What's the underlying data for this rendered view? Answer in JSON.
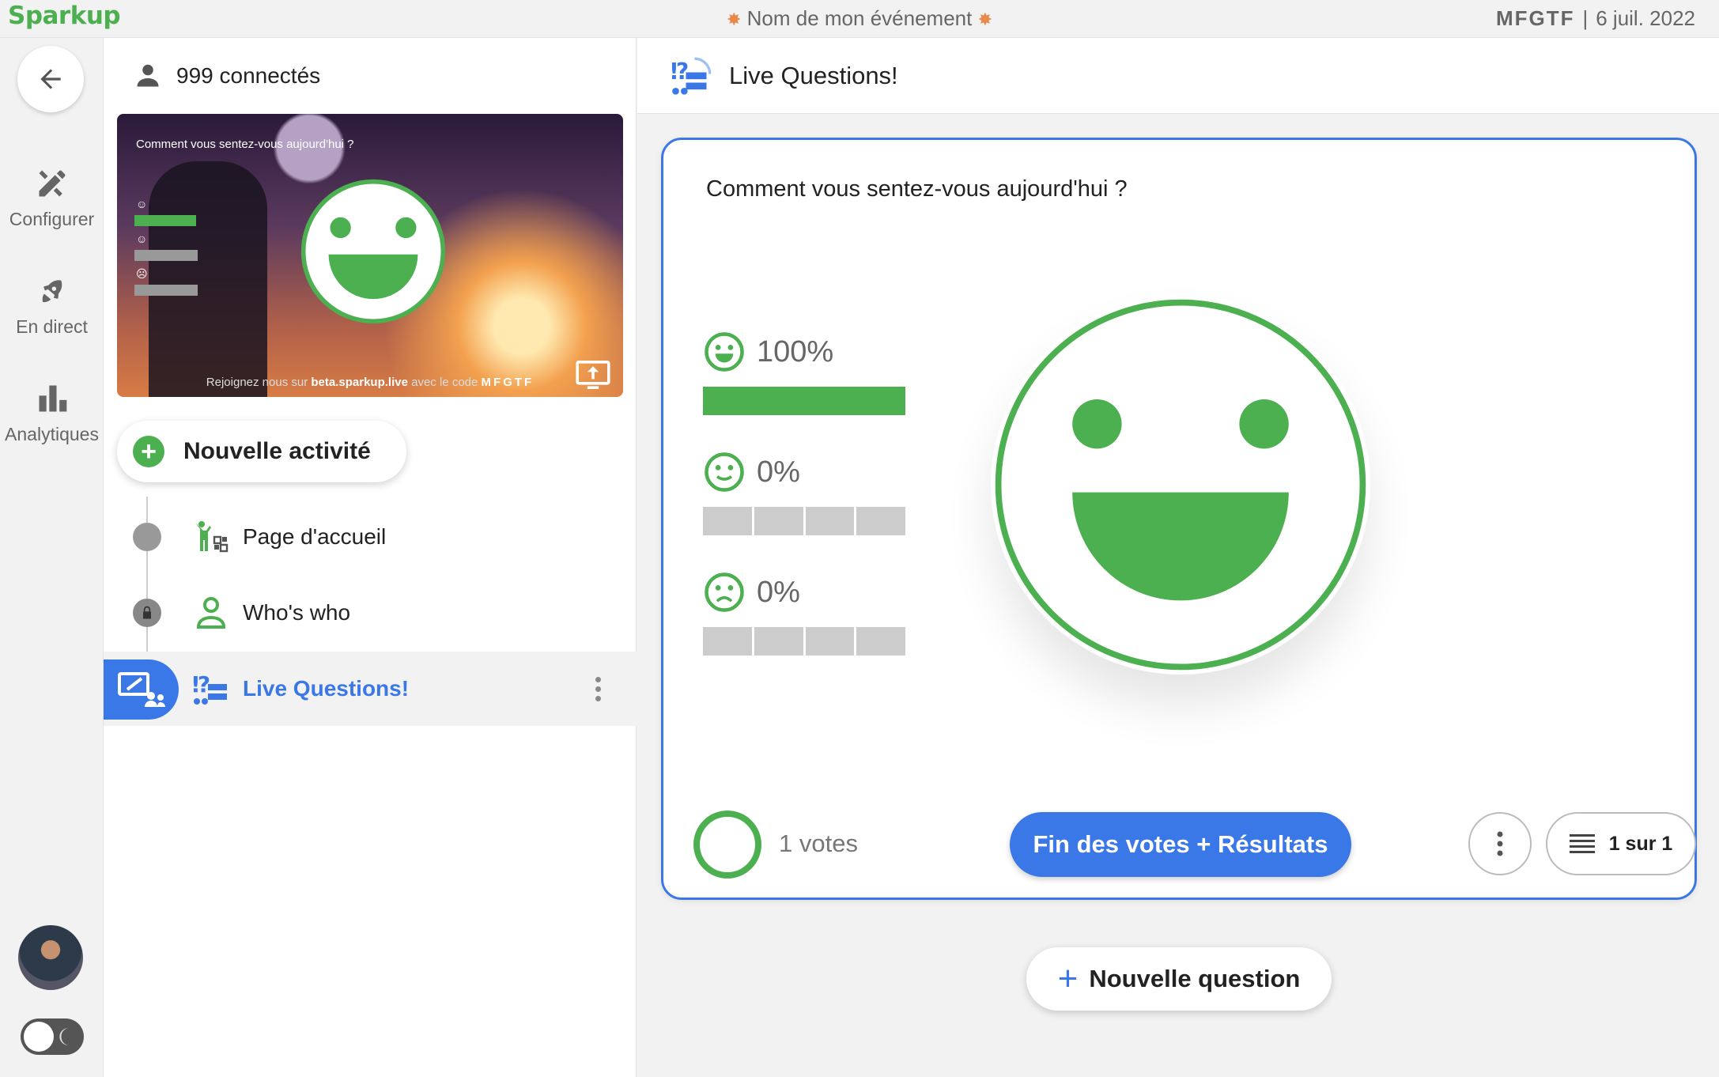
{
  "topbar": {
    "brand": "Sparkup",
    "event_title": "Nom de mon événement",
    "event_code": "MFGTF",
    "separator": "|",
    "date": "6 juil. 2022"
  },
  "leftnav": {
    "items": [
      {
        "label": "Configurer",
        "icon": "tools-icon"
      },
      {
        "label": "En direct",
        "icon": "rocket-icon"
      },
      {
        "label": "Analytiques",
        "icon": "bar-chart-icon"
      }
    ]
  },
  "middle": {
    "connected": "999 connectés",
    "preview": {
      "question": "Comment vous sentez-vous aujourd'hui ?",
      "footer_prefix": "Rejoignez nous sur",
      "footer_url": "beta.sparkup.live",
      "footer_mid": "avec le code",
      "footer_code": "MFGTF",
      "poll_values": [
        100,
        0,
        0
      ]
    },
    "new_activity": "Nouvelle activité",
    "activities": [
      {
        "label": "Page d'accueil",
        "state": "default"
      },
      {
        "label": "Who's who",
        "state": "locked"
      },
      {
        "label": "Live Questions!",
        "state": "active"
      }
    ]
  },
  "right": {
    "title": "Live Questions!",
    "question": "Comment vous sentez-vous aujourd'hui ?",
    "options": [
      {
        "icon": "happy-face-icon",
        "percent_label": "100%",
        "value": 100
      },
      {
        "icon": "neutral-face-icon",
        "percent_label": "0%",
        "value": 0
      },
      {
        "icon": "sad-face-icon",
        "percent_label": "0%",
        "value": 0
      }
    ],
    "votes": "1 votes",
    "end_button": "Fin des votes + Résultats",
    "pagination": "1 sur 1",
    "new_question": "Nouvelle question"
  },
  "colors": {
    "brand_green": "#4caf50",
    "accent_blue": "#3b78e7",
    "empty_bar": "#cccccc"
  }
}
